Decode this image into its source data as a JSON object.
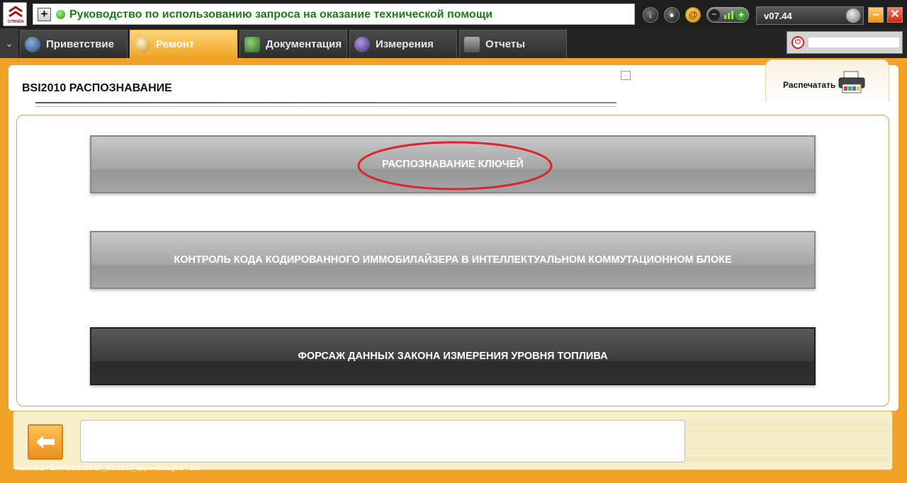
{
  "window": {
    "title": "Руководство по использованию запроса на оказание технической помощи",
    "version": "v07.44",
    "logo_text": "CITROËN"
  },
  "tabs": [
    {
      "label": "Приветствие",
      "icon": "globe-icon",
      "active": false
    },
    {
      "label": "Ремонт",
      "icon": "magnifier-icon",
      "active": true
    },
    {
      "label": "Документация",
      "icon": "book-icon",
      "active": false
    },
    {
      "label": "Измерения",
      "icon": "waveform-icon",
      "active": false
    },
    {
      "label": "Отчеты",
      "icon": "report-icon",
      "active": false
    }
  ],
  "page": {
    "title": "BSI2010  РАСПОЗНАВАНИЕ",
    "print_label": "Распечатать"
  },
  "actions": [
    {
      "label": "РАСПОЗНАВАНИЕ КЛЮЧЕЙ",
      "style": "gray",
      "highlighted": true
    },
    {
      "label": "КОНТРОЛЬ КОДА КОДИРОВАННОГО ИММОБИЛАЙЗЕРА В ИНТЕЛЛЕКТУАЛЬНОМ КОММУТАЦИОННОМ БЛОКЕ",
      "style": "gray",
      "highlighted": false
    },
    {
      "label": "ФОРСАЖ ДАННЫХ ЗАКОНА ИЗМЕРЕНИЯ УРОВНЯ ТОПЛИВА",
      "style": "dark",
      "highlighted": false
    }
  ],
  "status": {
    "path": "Vehicle\\B7\\BMF\\BSI2010\\B7_BSI2010_apprentissage.s : 399"
  },
  "colors": {
    "accent": "#f2a226",
    "title_green": "#1f7a1a",
    "highlight_ellipse": "#d9252b"
  }
}
